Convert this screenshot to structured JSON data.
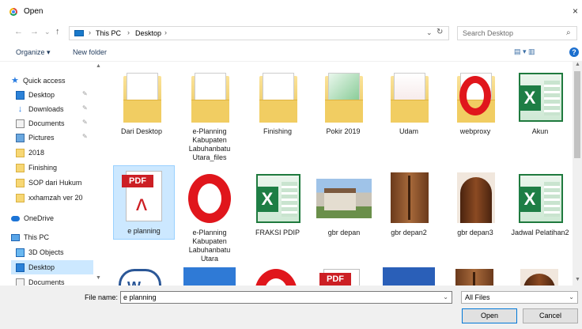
{
  "window": {
    "title": "Open",
    "close": "×"
  },
  "address": {
    "back": "←",
    "forward": "→",
    "recent": "⌄",
    "up": "↑",
    "crumbs": [
      "This PC",
      "Desktop"
    ],
    "separator": "›",
    "dropdown": "⌄",
    "refresh": "↻",
    "search_placeholder": "Search Desktop",
    "search_icon": "⌕"
  },
  "toolbar": {
    "organize": "Organize ▾",
    "new_folder": "New folder",
    "view_icons": "▤ ▾   ▥",
    "help": "?"
  },
  "nav": {
    "items": [
      {
        "label": "Quick access",
        "icon": "star-icon"
      },
      {
        "label": "Desktop",
        "icon": "desktop-icon",
        "pinned": true
      },
      {
        "label": "Downloads",
        "icon": "download-icon",
        "pinned": true
      },
      {
        "label": "Documents",
        "icon": "documents-icon",
        "pinned": true
      },
      {
        "label": "Pictures",
        "icon": "pictures-icon",
        "pinned": true
      },
      {
        "label": "2018",
        "icon": "folder-icon"
      },
      {
        "label": "Finishing",
        "icon": "folder-icon"
      },
      {
        "label": "SOP dari Hukum",
        "icon": "folder-icon"
      },
      {
        "label": "xxhamzah ver 20",
        "icon": "folder-icon"
      },
      {
        "label": "OneDrive",
        "icon": "cloud-icon"
      },
      {
        "label": "This PC",
        "icon": "computer-icon"
      },
      {
        "label": "3D Objects",
        "icon": "cube-icon"
      },
      {
        "label": "Desktop",
        "icon": "desktop-icon"
      },
      {
        "label": "Documents",
        "icon": "documents-icon"
      }
    ],
    "pin": "✎"
  },
  "files": [
    {
      "name": "Dari Desktop",
      "kind": "folder"
    },
    {
      "name": "e-Planning Kabupaten Labuhanbatu Utara_files",
      "kind": "folder"
    },
    {
      "name": "Finishing",
      "kind": "folder"
    },
    {
      "name": "Pokir 2019",
      "kind": "folder-excel"
    },
    {
      "name": "Udam",
      "kind": "folder-pdf"
    },
    {
      "name": "webproxy",
      "kind": "folder-opera"
    },
    {
      "name": "Akun",
      "kind": "excel"
    },
    {
      "name": "e planning",
      "kind": "pdf",
      "selected": true
    },
    {
      "name": "e-Planning Kabupaten Labuhanbatu Utara",
      "kind": "opera"
    },
    {
      "name": "FRAKSI PDIP",
      "kind": "excel"
    },
    {
      "name": "gbr depan",
      "kind": "photo-house"
    },
    {
      "name": "gbr depan2",
      "kind": "photo-door"
    },
    {
      "name": "gbr depan3",
      "kind": "photo-arch"
    },
    {
      "name": "Jadwal Pelatihan2",
      "kind": "excel"
    }
  ],
  "partial_row_icons": {
    "word": "W",
    "pdf": "PDF"
  },
  "footer": {
    "file_name_label": "File name:",
    "file_name_value": "e planning",
    "filter": "All Files",
    "open": "Open",
    "cancel": "Cancel",
    "dropdown": "⌄"
  }
}
